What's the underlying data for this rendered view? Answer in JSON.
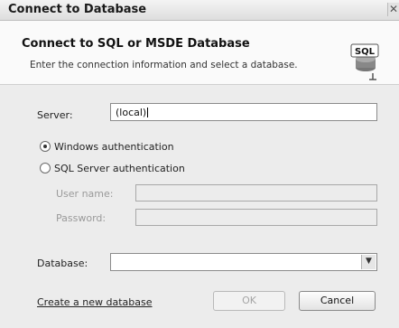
{
  "window": {
    "title": "Connect to Database",
    "close_glyph": "✕"
  },
  "header": {
    "title": "Connect to SQL or MSDE Database",
    "subtitle": "Enter the connection information and select a database.",
    "icon": "sql-database-icon",
    "icon_text": "SQL"
  },
  "server": {
    "label": "Server:",
    "value": "(local)"
  },
  "auth": {
    "windows_label": "Windows authentication",
    "sql_label": "SQL Server authentication",
    "selected": "windows"
  },
  "credentials": {
    "username_label": "User name:",
    "password_label": "Password:",
    "username_value": "",
    "password_value": ""
  },
  "database": {
    "label": "Database:",
    "value": ""
  },
  "footer": {
    "create_link": "Create a new database",
    "ok_label": "OK",
    "cancel_label": "Cancel"
  }
}
